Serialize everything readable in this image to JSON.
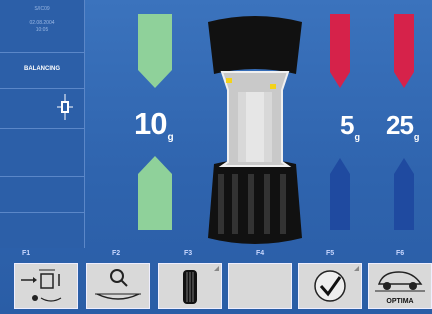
{
  "sidebar": {
    "info_lines": [
      "S/IC09",
      "02.08.2004",
      "10:05"
    ],
    "mode": "BALANCING"
  },
  "inner_plane": {
    "value": "10",
    "unit": "g"
  },
  "outer_plane_left": {
    "value": "5",
    "unit": "g"
  },
  "outer_plane_right": {
    "value": "25",
    "unit": "g"
  },
  "fkeys": [
    {
      "label": "F1",
      "icon": "settings-arrows-icon"
    },
    {
      "label": "F2",
      "icon": "magnifier-wheel-icon"
    },
    {
      "label": "F3",
      "icon": "tire-icon"
    },
    {
      "label": "F4",
      "icon": ""
    },
    {
      "label": "F5",
      "icon": "check-gauge-icon"
    },
    {
      "label": "F6",
      "icon": "optima-car-icon",
      "text": "OPTIMA"
    }
  ],
  "colors": {
    "background": "#2f63ad",
    "inner_green": "#8fd19a",
    "outer_red": "#d6224a",
    "outer_blue": "#1f4aa0"
  }
}
